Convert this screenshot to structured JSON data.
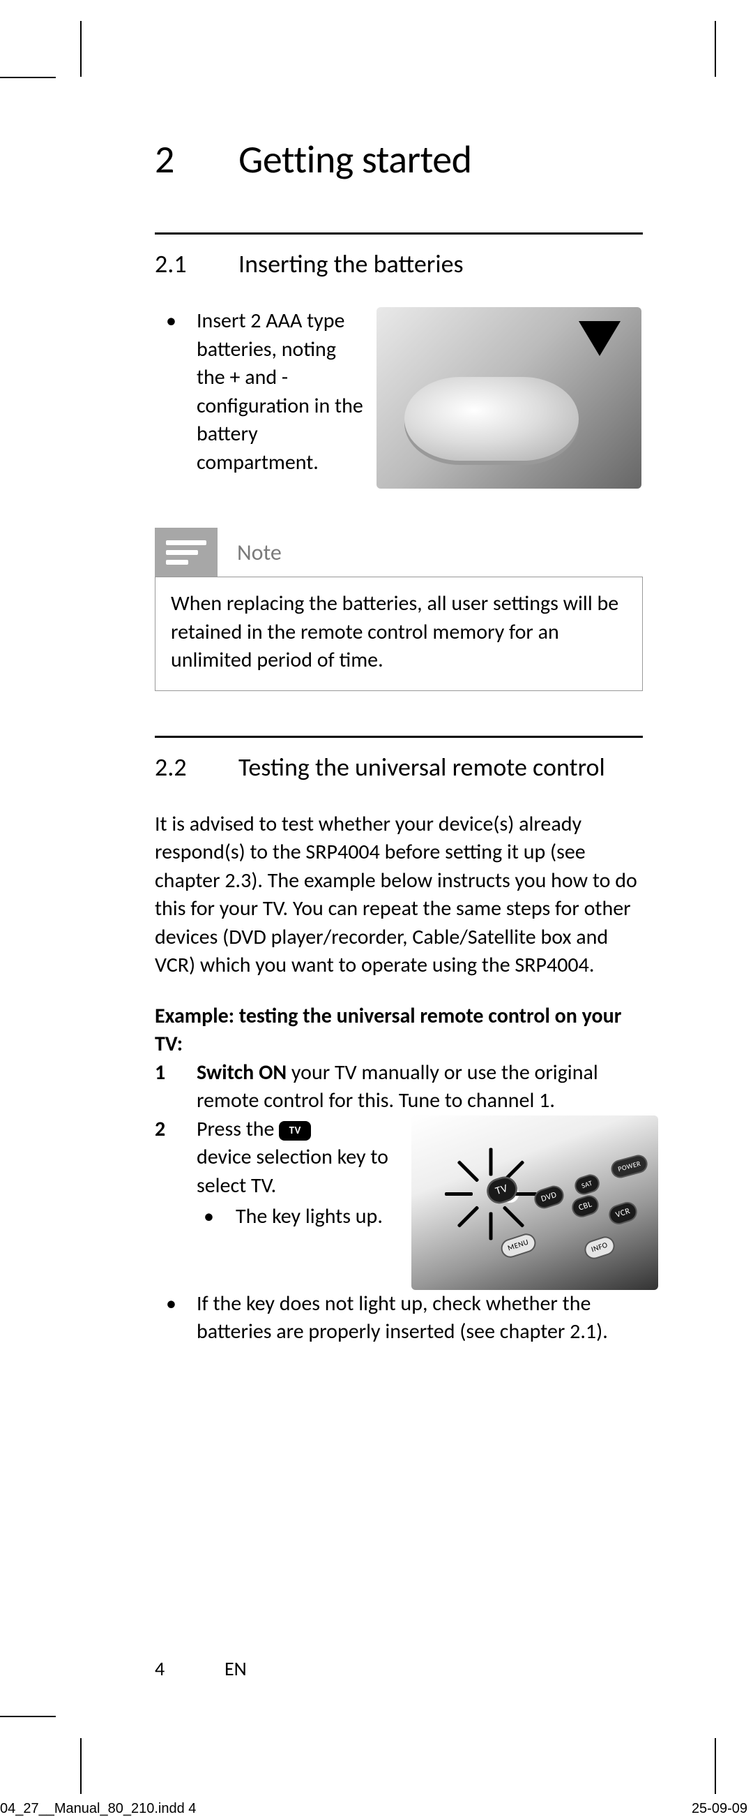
{
  "chapter": {
    "number": "2",
    "title": "Getting started"
  },
  "section_2_1": {
    "number": "2.1",
    "title": "Inserting the batteries",
    "bullet": "Insert 2 AAA type batteries, noting the + and - configuration in the battery compartment."
  },
  "note": {
    "label": "Note",
    "text": "When replacing the batteries, all user settings will be retained in the remote control memory for an unlimited period of time."
  },
  "section_2_2": {
    "number": "2.2",
    "title": "Testing the universal remote control",
    "intro": "It is advised to test whether your device(s) already respond(s) to the SRP4004 before setting it up (see chapter 2.3). The example below instructs you how to do this for your TV.  You can repeat the same steps for other devices (DVD player/recorder, Cable/Satellite box and VCR) which you want to operate using the SRP4004.",
    "example_lead": "Example: testing the universal remote control on your TV:",
    "step1": {
      "num": "1",
      "lead_strong": "Switch ON",
      "rest": " your TV manually or use the original remote control for this.  Tune to channel 1."
    },
    "step2": {
      "num": "2",
      "line1_a": "Press the ",
      "tv_chip": "TV",
      "line_rest": "device selection key to select TV.",
      "sub_bullet": "The key lights up.",
      "outer_bullet": "If the key does not light up, check whether the batteries are properly inserted (see chapter 2.1)."
    }
  },
  "remote_labels": {
    "tv": "TV",
    "dvd": "DVD",
    "sat": "SAT",
    "cbl": "CBL",
    "vcr": "VCR",
    "power": "POWER",
    "menu": "MENU",
    "info": "INFO"
  },
  "footer": {
    "page": "4",
    "lang": "EN"
  },
  "slug": {
    "left": "04_27__Manual_80_210.indd   4",
    "right": "25-09-09 "
  }
}
